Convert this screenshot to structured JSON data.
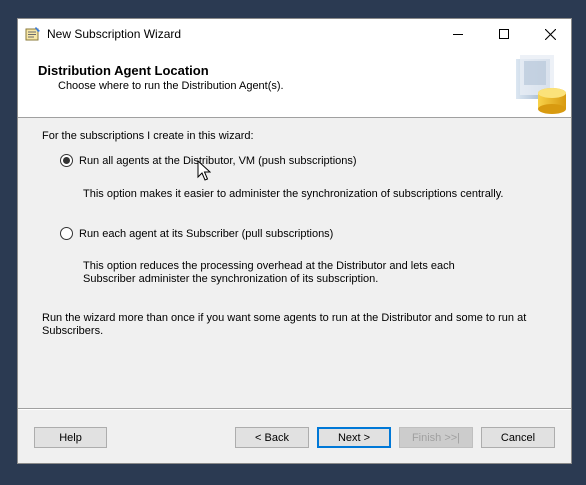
{
  "window": {
    "title": "New Subscription Wizard"
  },
  "header": {
    "title": "Distribution Agent Location",
    "subtitle": "Choose where to run the Distribution Agent(s)."
  },
  "content": {
    "intro": "For the subscriptions I create in this wizard:",
    "option_push": {
      "label": "Run all agents at the Distributor, VM (push subscriptions)",
      "selected": true,
      "description": "This option makes it easier to administer the synchronization of subscriptions centrally."
    },
    "option_pull": {
      "label": "Run each agent at its Subscriber (pull subscriptions)",
      "selected": false,
      "description_line1": "This option reduces the processing overhead at the Distributor and lets each",
      "description_line2": "Subscriber administer the synchronization of its subscription."
    },
    "note_line1": "Run the wizard more than once if you want some agents to run at the Distributor and some to run at",
    "note_line2": "Subscribers."
  },
  "buttons": {
    "help": "Help",
    "back": "< Back",
    "next": "Next >",
    "finish": "Finish >>|",
    "cancel": "Cancel"
  },
  "icons": {
    "app": "wizard-app-icon",
    "header_art": "database-agent-icon",
    "cursor": "mouse-pointer-icon"
  },
  "colors": {
    "desktop": "#2b3a52",
    "dialog": "#f0f0f0",
    "accent": "#0078d7"
  }
}
